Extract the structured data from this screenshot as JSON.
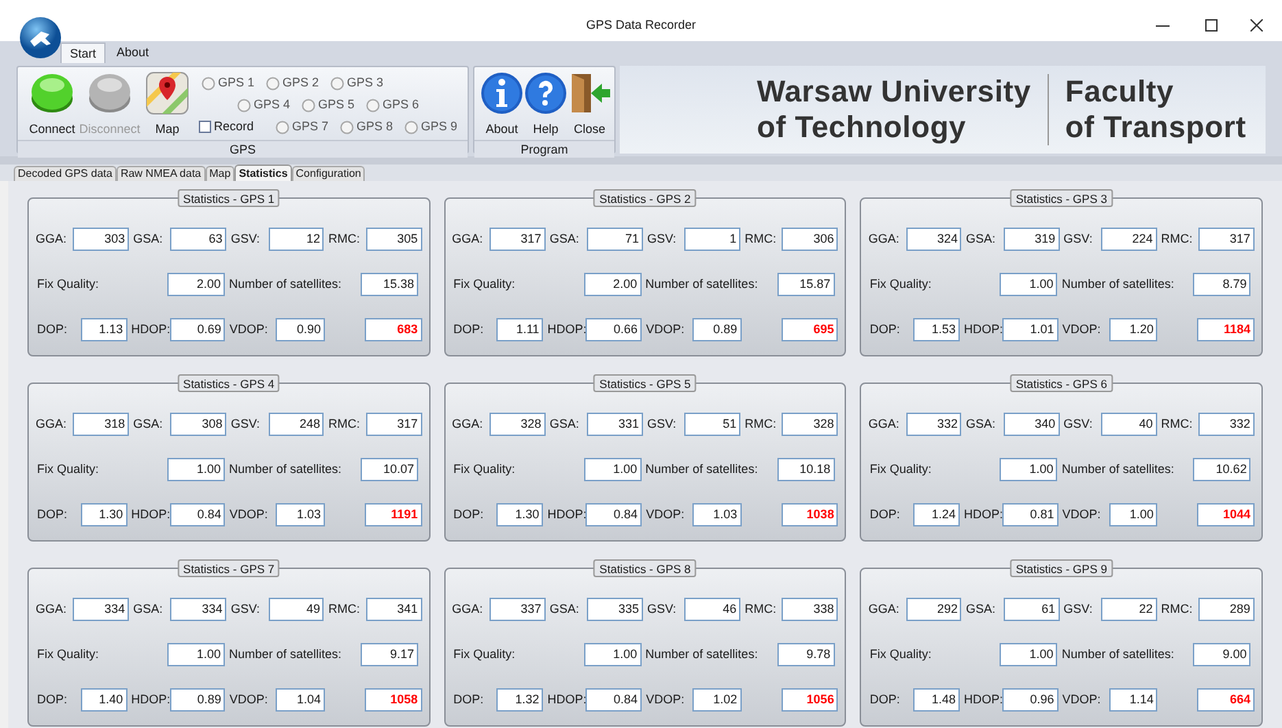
{
  "window": {
    "title": "GPS Data Recorder"
  },
  "ribbon_tabs": [
    {
      "label": "Start",
      "selected": true
    },
    {
      "label": "About",
      "selected": false
    }
  ],
  "gps_group": {
    "caption": "GPS",
    "buttons": [
      {
        "label": "Connect",
        "kind": "connect",
        "disabled": false
      },
      {
        "label": "Disconnect",
        "kind": "disconnect",
        "disabled": true
      },
      {
        "label": "Map",
        "kind": "map",
        "disabled": false
      }
    ],
    "record": {
      "label": "Record",
      "checked": false
    },
    "radios": [
      {
        "label": "GPS 1",
        "selected": false
      },
      {
        "label": "GPS 2",
        "selected": false
      },
      {
        "label": "GPS 3",
        "selected": false
      },
      {
        "label": "GPS 4",
        "selected": false
      },
      {
        "label": "GPS 5",
        "selected": false
      },
      {
        "label": "GPS 6",
        "selected": false
      },
      {
        "label": "GPS 7",
        "selected": false
      },
      {
        "label": "GPS 8",
        "selected": false
      },
      {
        "label": "GPS 9",
        "selected": false
      }
    ]
  },
  "program_group": {
    "caption": "Program",
    "buttons": [
      {
        "label": "About",
        "kind": "info"
      },
      {
        "label": "Help",
        "kind": "help"
      },
      {
        "label": "Close",
        "kind": "exit"
      }
    ]
  },
  "logo": {
    "left": [
      "Warsaw University",
      "of Technology"
    ],
    "right": [
      "Faculty",
      "of Transport"
    ]
  },
  "tabs": [
    {
      "label": "Decoded GPS data",
      "selected": false
    },
    {
      "label": "Raw NMEA data",
      "selected": false
    },
    {
      "label": "Map",
      "selected": false
    },
    {
      "label": "Statistics",
      "selected": true
    },
    {
      "label": "Configuration",
      "selected": false
    }
  ],
  "panels": [
    {
      "title": "Statistics - GPS 1",
      "counts": [
        {
          "label": "GGA:",
          "value": "303"
        },
        {
          "label": "GSA:",
          "value": "63"
        },
        {
          "label": "GSV:",
          "value": "12"
        },
        {
          "label": "RMC:",
          "value": "305"
        }
      ],
      "fix": [
        {
          "label": "Fix Quality:",
          "value": "2.00"
        },
        {
          "label": "Number of satellites:",
          "value": "15.38"
        }
      ],
      "dop": [
        {
          "label": "DOP:",
          "value": "1.13"
        },
        {
          "label": "HDOP:",
          "value": "0.69"
        },
        {
          "label": "VDOP:",
          "value": "0.90"
        }
      ],
      "extra": "683"
    },
    {
      "title": "Statistics - GPS 2",
      "counts": [
        {
          "label": "GGA:",
          "value": "317"
        },
        {
          "label": "GSA:",
          "value": "71"
        },
        {
          "label": "GSV:",
          "value": "1"
        },
        {
          "label": "RMC:",
          "value": "306"
        }
      ],
      "fix": [
        {
          "label": "Fix Quality:",
          "value": "2.00"
        },
        {
          "label": "Number of satellites:",
          "value": "15.87"
        }
      ],
      "dop": [
        {
          "label": "DOP:",
          "value": "1.11"
        },
        {
          "label": "HDOP:",
          "value": "0.66"
        },
        {
          "label": "VDOP:",
          "value": "0.89"
        }
      ],
      "extra": "695"
    },
    {
      "title": "Statistics - GPS 3",
      "counts": [
        {
          "label": "GGA:",
          "value": "324"
        },
        {
          "label": "GSA:",
          "value": "319"
        },
        {
          "label": "GSV:",
          "value": "224"
        },
        {
          "label": "RMC:",
          "value": "317"
        }
      ],
      "fix": [
        {
          "label": "Fix Quality:",
          "value": "1.00"
        },
        {
          "label": "Number of satellites:",
          "value": "8.79"
        }
      ],
      "dop": [
        {
          "label": "DOP:",
          "value": "1.53"
        },
        {
          "label": "HDOP:",
          "value": "1.01"
        },
        {
          "label": "VDOP:",
          "value": "1.20"
        }
      ],
      "extra": "1184"
    },
    {
      "title": "Statistics - GPS 4",
      "counts": [
        {
          "label": "GGA:",
          "value": "318"
        },
        {
          "label": "GSA:",
          "value": "308"
        },
        {
          "label": "GSV:",
          "value": "248"
        },
        {
          "label": "RMC:",
          "value": "317"
        }
      ],
      "fix": [
        {
          "label": "Fix Quality:",
          "value": "1.00"
        },
        {
          "label": "Number of satellites:",
          "value": "10.07"
        }
      ],
      "dop": [
        {
          "label": "DOP:",
          "value": "1.30"
        },
        {
          "label": "HDOP:",
          "value": "0.84"
        },
        {
          "label": "VDOP:",
          "value": "1.03"
        }
      ],
      "extra": "1191"
    },
    {
      "title": "Statistics - GPS 5",
      "counts": [
        {
          "label": "GGA:",
          "value": "328"
        },
        {
          "label": "GSA:",
          "value": "331"
        },
        {
          "label": "GSV:",
          "value": "51"
        },
        {
          "label": "RMC:",
          "value": "328"
        }
      ],
      "fix": [
        {
          "label": "Fix Quality:",
          "value": "1.00"
        },
        {
          "label": "Number of satellites:",
          "value": "10.18"
        }
      ],
      "dop": [
        {
          "label": "DOP:",
          "value": "1.30"
        },
        {
          "label": "HDOP:",
          "value": "0.84"
        },
        {
          "label": "VDOP:",
          "value": "1.03"
        }
      ],
      "extra": "1038"
    },
    {
      "title": "Statistics - GPS 6",
      "counts": [
        {
          "label": "GGA:",
          "value": "332"
        },
        {
          "label": "GSA:",
          "value": "340"
        },
        {
          "label": "GSV:",
          "value": "40"
        },
        {
          "label": "RMC:",
          "value": "332"
        }
      ],
      "fix": [
        {
          "label": "Fix Quality:",
          "value": "1.00"
        },
        {
          "label": "Number of satellites:",
          "value": "10.62"
        }
      ],
      "dop": [
        {
          "label": "DOP:",
          "value": "1.24"
        },
        {
          "label": "HDOP:",
          "value": "0.81"
        },
        {
          "label": "VDOP:",
          "value": "1.00"
        }
      ],
      "extra": "1044"
    },
    {
      "title": "Statistics - GPS 7",
      "counts": [
        {
          "label": "GGA:",
          "value": "334"
        },
        {
          "label": "GSA:",
          "value": "334"
        },
        {
          "label": "GSV:",
          "value": "49"
        },
        {
          "label": "RMC:",
          "value": "341"
        }
      ],
      "fix": [
        {
          "label": "Fix Quality:",
          "value": "1.00"
        },
        {
          "label": "Number of satellites:",
          "value": "9.17"
        }
      ],
      "dop": [
        {
          "label": "DOP:",
          "value": "1.40"
        },
        {
          "label": "HDOP:",
          "value": "0.89"
        },
        {
          "label": "VDOP:",
          "value": "1.04"
        }
      ],
      "extra": "1058"
    },
    {
      "title": "Statistics - GPS 8",
      "counts": [
        {
          "label": "GGA:",
          "value": "337"
        },
        {
          "label": "GSA:",
          "value": "335"
        },
        {
          "label": "GSV:",
          "value": "46"
        },
        {
          "label": "RMC:",
          "value": "338"
        }
      ],
      "fix": [
        {
          "label": "Fix Quality:",
          "value": "1.00"
        },
        {
          "label": "Number of satellites:",
          "value": "9.78"
        }
      ],
      "dop": [
        {
          "label": "DOP:",
          "value": "1.32"
        },
        {
          "label": "HDOP:",
          "value": "0.84"
        },
        {
          "label": "VDOP:",
          "value": "1.02"
        }
      ],
      "extra": "1056"
    },
    {
      "title": "Statistics - GPS 9",
      "counts": [
        {
          "label": "GGA:",
          "value": "292"
        },
        {
          "label": "GSA:",
          "value": "61"
        },
        {
          "label": "GSV:",
          "value": "22"
        },
        {
          "label": "RMC:",
          "value": "289"
        }
      ],
      "fix": [
        {
          "label": "Fix Quality:",
          "value": "1.00"
        },
        {
          "label": "Number of satellites:",
          "value": "9.00"
        }
      ],
      "dop": [
        {
          "label": "DOP:",
          "value": "1.48"
        },
        {
          "label": "HDOP:",
          "value": "0.96"
        },
        {
          "label": "VDOP:",
          "value": "1.14"
        }
      ],
      "extra": "664"
    }
  ]
}
